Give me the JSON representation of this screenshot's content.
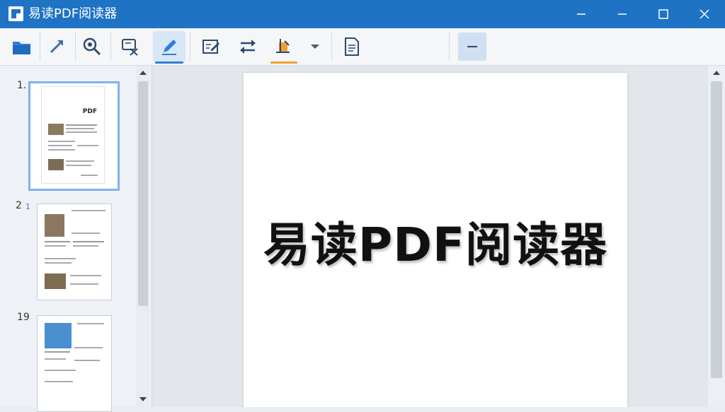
{
  "window": {
    "title": "易读PDF阅读器",
    "icon": "app-logo-icon"
  },
  "toolbar": {
    "buttons": [
      {
        "name": "open-folder-icon"
      },
      {
        "name": "select-arrow-icon"
      },
      {
        "name": "zoom-icon"
      },
      {
        "name": "crop-icon"
      },
      {
        "name": "pen-icon"
      },
      {
        "name": "edit-icon"
      },
      {
        "name": "swap-icon"
      },
      {
        "name": "highlight-icon"
      },
      {
        "name": "dropdown-icon"
      },
      {
        "name": "document-icon"
      },
      {
        "name": "minus-icon"
      }
    ]
  },
  "sidebar": {
    "thumbnails": [
      {
        "number": "1.",
        "heading": "PDF"
      },
      {
        "number": "2",
        "badge": "1"
      },
      {
        "number": "19"
      }
    ]
  },
  "document": {
    "title": "易读PDF阅读器"
  },
  "colors": {
    "titlebar": "#1f73c4",
    "accent": "#2f7fd6",
    "highlight_underline": "#f0a030"
  }
}
